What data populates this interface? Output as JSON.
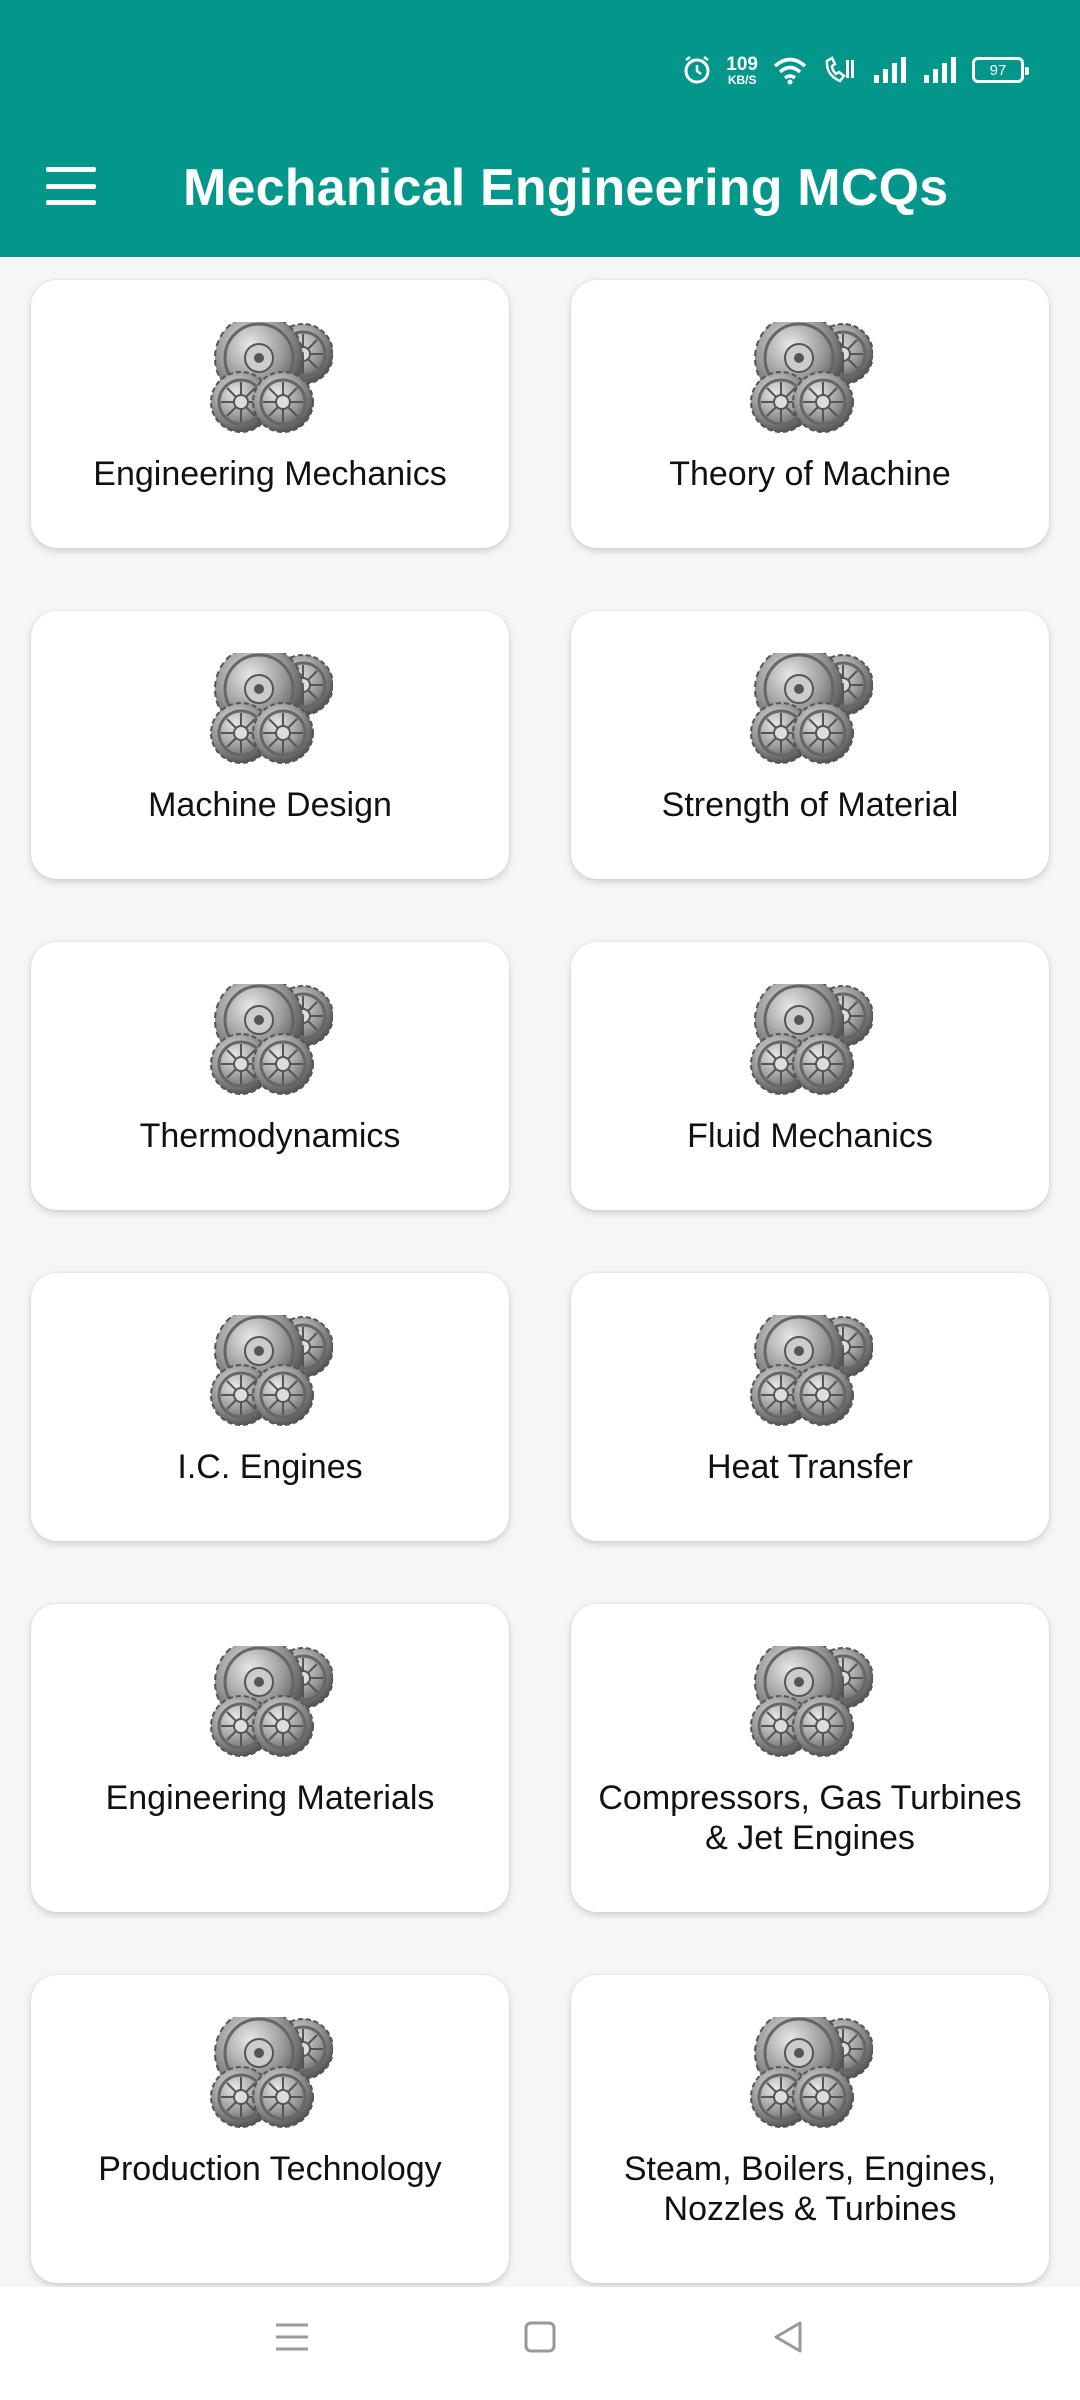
{
  "status_bar": {
    "net_speed_value": "109",
    "net_speed_unit": "KB/S",
    "battery": "97",
    "icons": [
      "alarm-icon",
      "wifi-icon",
      "volte-call-icon",
      "signal-icon",
      "signal-icon",
      "battery-icon"
    ]
  },
  "appbar": {
    "menu_icon": "hamburger-menu-icon",
    "title": "Mechanical Engineering MCQs"
  },
  "topics": [
    {
      "label": "Engineering Mechanics",
      "icon": "gears-icon"
    },
    {
      "label": "Theory of Machine",
      "icon": "gears-icon"
    },
    {
      "label": "Machine Design",
      "icon": "gears-icon"
    },
    {
      "label": "Strength of Material",
      "icon": "gears-icon"
    },
    {
      "label": "Thermodynamics",
      "icon": "gears-icon"
    },
    {
      "label": "Fluid Mechanics",
      "icon": "gears-icon"
    },
    {
      "label": "I.C. Engines",
      "icon": "gears-icon"
    },
    {
      "label": "Heat Transfer",
      "icon": "gears-icon"
    },
    {
      "label": "Engineering Materials",
      "icon": "gears-icon"
    },
    {
      "label": "Compressors, Gas Turbines & Jet Engines",
      "icon": "gears-icon"
    },
    {
      "label": "Production Technology",
      "icon": "gears-icon"
    },
    {
      "label": "Steam, Boilers, Engines, Nozzles & Turbines",
      "icon": "gears-icon"
    }
  ],
  "navbar": {
    "icons": [
      "recent-apps-icon",
      "home-icon",
      "back-icon"
    ]
  }
}
